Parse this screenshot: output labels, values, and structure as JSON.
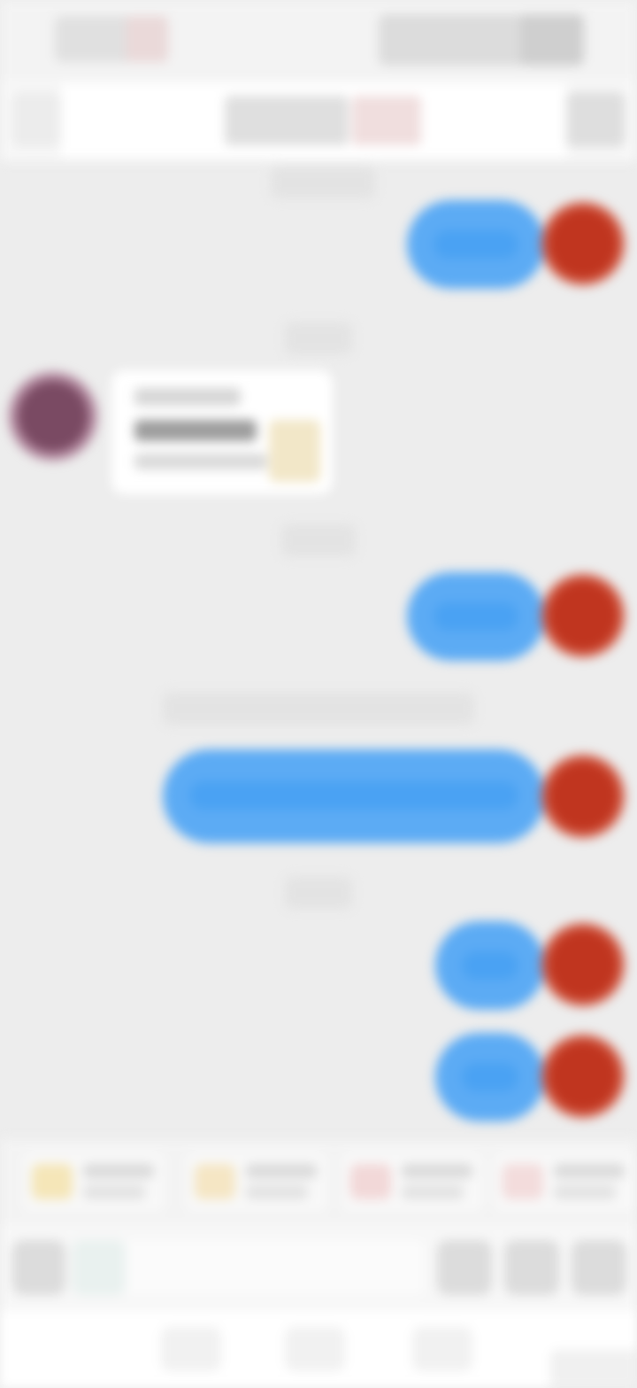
{
  "status_bar": {
    "time": "",
    "indicators": ""
  },
  "nav": {
    "title": "",
    "back_icon": "chevron-left-icon",
    "more_icon": "more-icon"
  },
  "messages": [
    {
      "side": "right",
      "kind": "text",
      "text": ""
    },
    {
      "side": "left",
      "kind": "card",
      "title": "",
      "subtitle": "",
      "caption": ""
    },
    {
      "side": "right",
      "kind": "text",
      "text": ""
    },
    {
      "side": "right",
      "kind": "text",
      "text": ""
    },
    {
      "side": "right",
      "kind": "text",
      "text": ""
    },
    {
      "side": "right",
      "kind": "text",
      "text": ""
    }
  ],
  "timestamps": [
    "",
    "",
    "",
    "",
    ""
  ],
  "quick_actions": [
    {
      "label": "",
      "sub": "",
      "color": "#f5e6b8"
    },
    {
      "label": "",
      "sub": "",
      "color": "#f5e6c4"
    },
    {
      "label": "",
      "sub": "",
      "color": "#f2d8d8"
    },
    {
      "label": "",
      "sub": "",
      "color": "#f3dcdc"
    }
  ],
  "input": {
    "placeholder": "",
    "voice_icon": "microphone-icon",
    "emoji_icon": "emoji-icon",
    "add_icon": "plus-icon"
  },
  "colors": {
    "bubble": "#5cabf4",
    "background": "#ededed",
    "avatar_self": "#c0351f"
  }
}
